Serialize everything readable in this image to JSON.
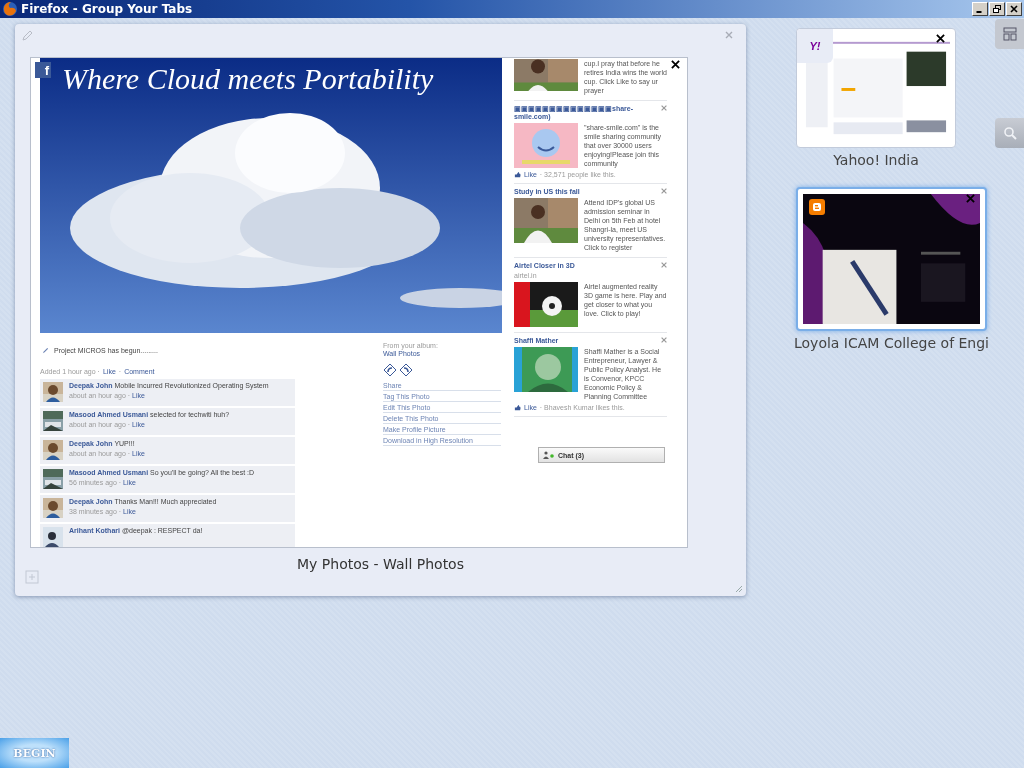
{
  "window": {
    "title": "Firefox - Group Your Tabs"
  },
  "group": {
    "tab": {
      "title": "My Photos - Wall Photos",
      "favicon_letter": "f",
      "page": {
        "photo_caption": "Where Cloud meets Portability",
        "post": "Project MICROS has begun.........",
        "meta": [
          {
            "kind": "plain",
            "text": "Added 1 hour ago ·"
          },
          {
            "kind": "link",
            "text": "Like"
          },
          {
            "kind": "plain",
            "text": "·"
          },
          {
            "kind": "link",
            "text": "Comment"
          }
        ],
        "comments": [
          {
            "author": "Deepak John",
            "text": "Mobile Incurred Revolutionized Operating System",
            "time": "about an hour ago ·",
            "like": "Like"
          },
          {
            "author": "Masood Ahmed Usmani",
            "text": "selected for techwiti huh?",
            "time": "about an hour ago ·",
            "like": "Like"
          },
          {
            "author": "Deepak John",
            "text": "YUP!!!",
            "time": "about an hour ago ·",
            "like": "Like"
          },
          {
            "author": "Masood Ahmed Usmani",
            "text": "So you'll be going? All the best :D",
            "time": "56 minutes ago ·",
            "like": "Like"
          },
          {
            "author": "Deepak John",
            "text": "Thanks Man!!! Much appreciated",
            "time": "38 minutes ago ·",
            "like": "Like"
          },
          {
            "author": "Arihant Kothari",
            "text": "@deepak : RESPECT da!"
          }
        ],
        "album_label": "From your album:",
        "album": "Wall Photos",
        "actions": [
          "Share",
          "Tag This Photo",
          "Edit This Photo",
          "Delete This Photo",
          "Make Profile Picture",
          "Download in High Resolution"
        ],
        "ads": [
          {
            "text": "cup.I pray that before he retires India wins the world cup. Click Like to say ur prayer"
          },
          {
            "title": "▣▣▣▣▣▣▣▣▣▣▣▣▣▣share-smile.com)",
            "text": "\"share-smile.com\" is the smile sharing community that over 30000 users enjoying!Please join this community",
            "like": "Like",
            "social": "· 32,571 people like this."
          },
          {
            "title": "Study in US this fall",
            "text": "Attend IDP's global US admission seminar in Delhi on 5th Feb at hotel Shangri-la, meet US university representatives. Click to register"
          },
          {
            "title": "Airtel Closer in 3D",
            "source": "airtel.in",
            "text": "Airtel augmented reality 3D game is here. Play and get closer to what you love. Click to play!"
          },
          {
            "title": "Shaffi Mather",
            "text": "Shaffi Mather is a Social Entrepreneur, Lawyer & Public Policy Analyst. He is Convenor, KPCC Economic Policy & Planning Committee",
            "like": "Like",
            "social": "· Bhavesh Kumar likes this."
          }
        ],
        "chat": "Chat (3)"
      }
    }
  },
  "ungrouped_tabs": [
    {
      "title": "Yahoo! India",
      "badge": "Y!",
      "selected": false
    },
    {
      "title": "Loyola ICAM College of Engi",
      "selected": true
    }
  ],
  "start_button": "BEGIN"
}
